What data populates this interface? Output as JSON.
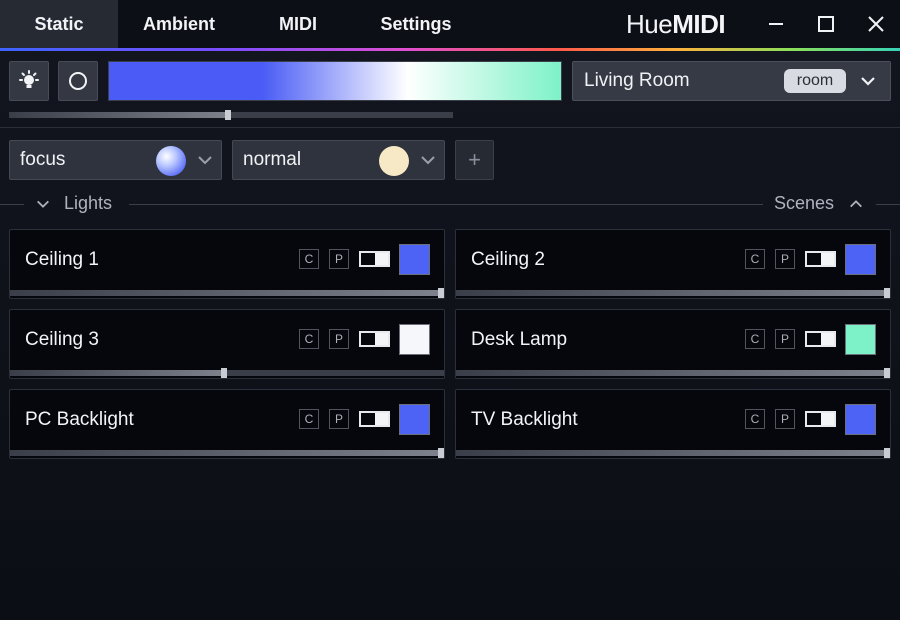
{
  "tabs": [
    {
      "label": "Static",
      "active": true
    },
    {
      "label": "Ambient",
      "active": false
    },
    {
      "label": "MIDI",
      "active": false
    },
    {
      "label": "Settings",
      "active": false
    }
  ],
  "brand": {
    "prefix": "Hue",
    "suffix": "MIDI"
  },
  "window_controls": [
    "minimize-icon",
    "maximize-icon",
    "close-icon"
  ],
  "toolbar": {
    "brightness_icon": "sun-icon",
    "power_icon": "circle-icon",
    "gradient_colors": [
      "#4a5cf5",
      "#4a5cf5",
      "#ffffff",
      "#7df2c8"
    ],
    "master_level": 0.5
  },
  "room_select": {
    "value": "Living Room",
    "badge": "room"
  },
  "scene_selects": [
    {
      "value": "focus",
      "swatch": "#8fa8ff"
    },
    {
      "value": "normal",
      "swatch": "#f7e8c6"
    }
  ],
  "add_label": "+",
  "sections": {
    "left": "Lights",
    "right": "Scenes"
  },
  "lights": [
    {
      "name": "Ceiling 1",
      "c": "C",
      "p": "P",
      "on": true,
      "color": "#4c63f5",
      "level": 1.0
    },
    {
      "name": "Ceiling 2",
      "c": "C",
      "p": "P",
      "on": true,
      "color": "#4c63f5",
      "level": 1.0
    },
    {
      "name": "Ceiling 3",
      "c": "C",
      "p": "P",
      "on": true,
      "color": "#f6f7fa",
      "level": 0.5
    },
    {
      "name": "Desk Lamp",
      "c": "C",
      "p": "P",
      "on": true,
      "color": "#7df2c8",
      "level": 1.0
    },
    {
      "name": "PC Backlight",
      "c": "C",
      "p": "P",
      "on": true,
      "color": "#4c63f5",
      "level": 1.0
    },
    {
      "name": "TV Backlight",
      "c": "C",
      "p": "P",
      "on": true,
      "color": "#4c63f5",
      "level": 1.0
    }
  ]
}
